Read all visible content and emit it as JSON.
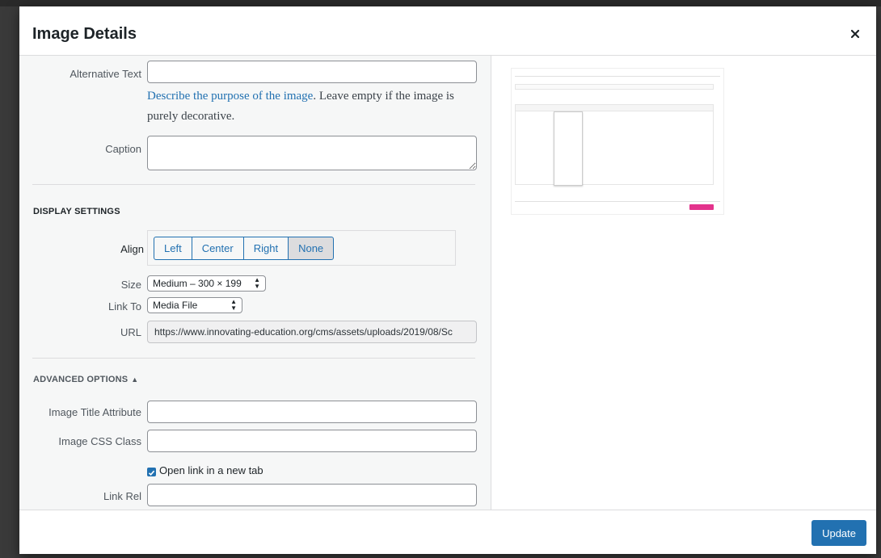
{
  "modal": {
    "title": "Image Details",
    "close_label": "×"
  },
  "alt_text": {
    "label": "Alternative Text",
    "value": "",
    "hint_link": "Describe the purpose of the image",
    "hint_rest": ". Leave empty if the image is purely decorative."
  },
  "caption": {
    "label": "Caption",
    "value": ""
  },
  "display_settings": {
    "heading": "DISPLAY SETTINGS",
    "align_label": "Align",
    "align_options": [
      "Left",
      "Center",
      "Right",
      "None"
    ],
    "align_selected": "None",
    "size_label": "Size",
    "size_value": "Medium – 300 × 199",
    "link_to_label": "Link To",
    "link_to_value": "Media File",
    "url_label": "URL",
    "url_value": "https://www.innovating-education.org/cms/assets/uploads/2019/08/Sc"
  },
  "advanced": {
    "heading": "ADVANCED OPTIONS",
    "toggle_icon": "triangle-up-icon",
    "title_attr_label": "Image Title Attribute",
    "title_attr_value": "",
    "css_class_label": "Image CSS Class",
    "css_class_value": "",
    "new_tab_label": "Open link in a new tab",
    "new_tab_checked": true,
    "link_rel_label": "Link Rel",
    "link_rel_value": ""
  },
  "footer": {
    "update_label": "Update"
  },
  "colors": {
    "accent": "#2271b1",
    "pink_button": "#e3338c"
  }
}
